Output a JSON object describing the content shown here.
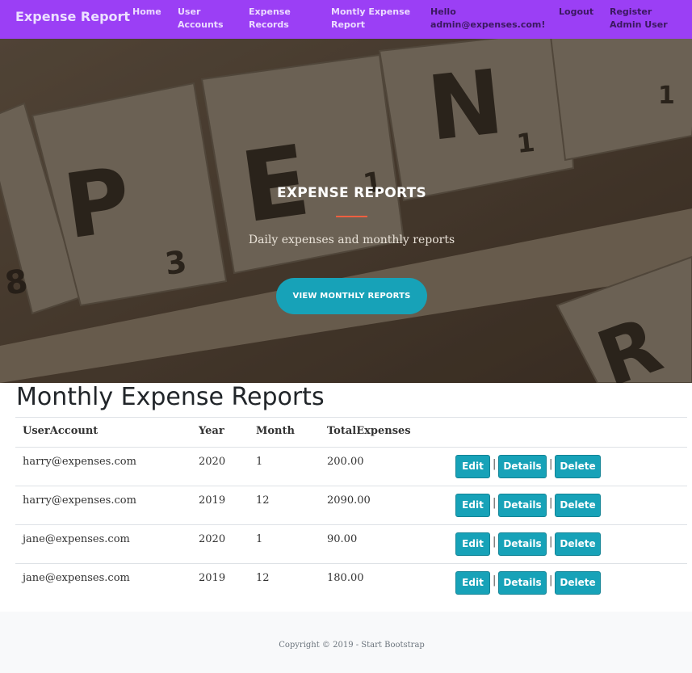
{
  "navbar": {
    "brand": "Expense Report",
    "links": [
      {
        "label": "Home"
      },
      {
        "label": "User Accounts"
      },
      {
        "label": "Expense Records"
      },
      {
        "label": "Montly Expense Report"
      },
      {
        "label": "Hello admin@expenses.com!"
      },
      {
        "label": "Logout"
      },
      {
        "label": "Register Admin User"
      }
    ]
  },
  "hero": {
    "title": "EXPENSE REPORTS",
    "subtitle": "Daily expenses and monthly reports",
    "button_label": "VIEW MONTHLY REPORTS",
    "accent_color": "#f05f40",
    "tile_letters": [
      "P",
      "3",
      "E",
      "1",
      "N",
      "1",
      "8",
      "R",
      "1"
    ]
  },
  "report": {
    "heading": "Monthly Expense Reports",
    "columns": [
      "UserAccount",
      "Year",
      "Month",
      "TotalExpenses"
    ],
    "rows": [
      {
        "user": "harry@expenses.com",
        "year": "2020",
        "month": "1",
        "total": "200.00"
      },
      {
        "user": "harry@expenses.com",
        "year": "2019",
        "month": "12",
        "total": "2090.00"
      },
      {
        "user": "jane@expenses.com",
        "year": "2020",
        "month": "1",
        "total": "90.00"
      },
      {
        "user": "jane@expenses.com",
        "year": "2019",
        "month": "12",
        "total": "180.00"
      }
    ],
    "actions": {
      "edit": "Edit",
      "details": "Details",
      "delete": "Delete",
      "separator": "|"
    }
  },
  "footer": {
    "copyright": "Copyright © 2019 - Start Bootstrap"
  },
  "colors": {
    "navbar": "#9b3ff5",
    "button": "#17a2b8",
    "footer": "#f8f9fa"
  }
}
